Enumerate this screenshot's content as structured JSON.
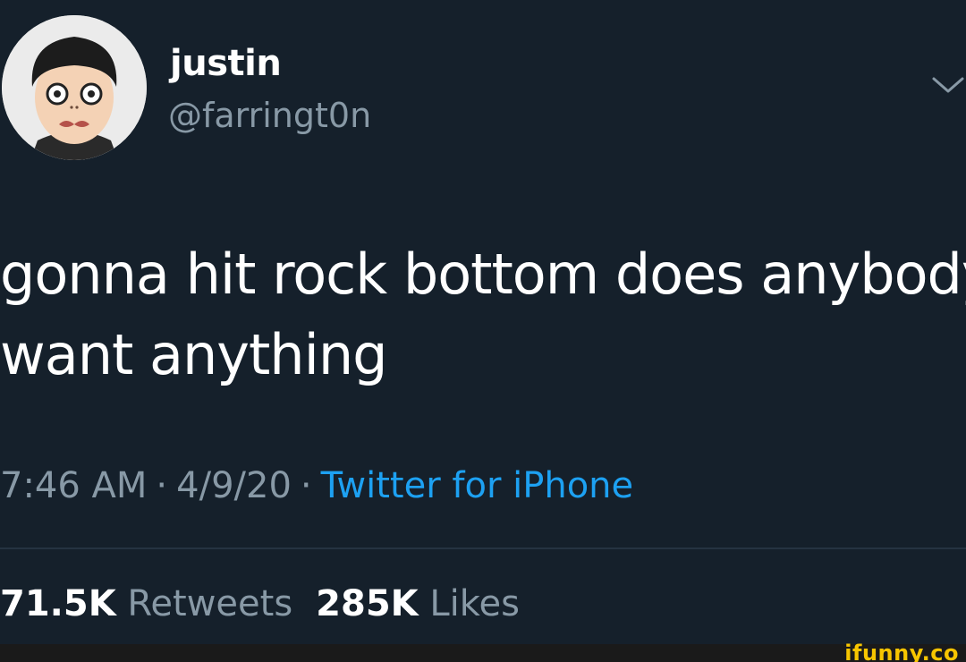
{
  "tweet": {
    "author": {
      "display_name": "justin",
      "handle": "@farringt0n",
      "avatar_icon": "avatar-cartoon-face"
    },
    "text_line_1": "gonna hit rock bottom does anybody",
    "text_line_2": "want anything",
    "time": "7:46 AM",
    "separator": "·",
    "date": "4/9/20",
    "source": "Twitter for iPhone",
    "stats": {
      "retweets_count": "71.5K",
      "retweets_label": "Retweets",
      "likes_count": "285K",
      "likes_label": "Likes"
    },
    "menu_icon": "chevron-down-icon"
  },
  "watermark": {
    "text": "ifunny.co"
  },
  "colors": {
    "background": "#15202b",
    "primary_text": "#ffffff",
    "secondary_text": "#8899a6",
    "link": "#1da1f2",
    "watermark": "#f7c500"
  }
}
